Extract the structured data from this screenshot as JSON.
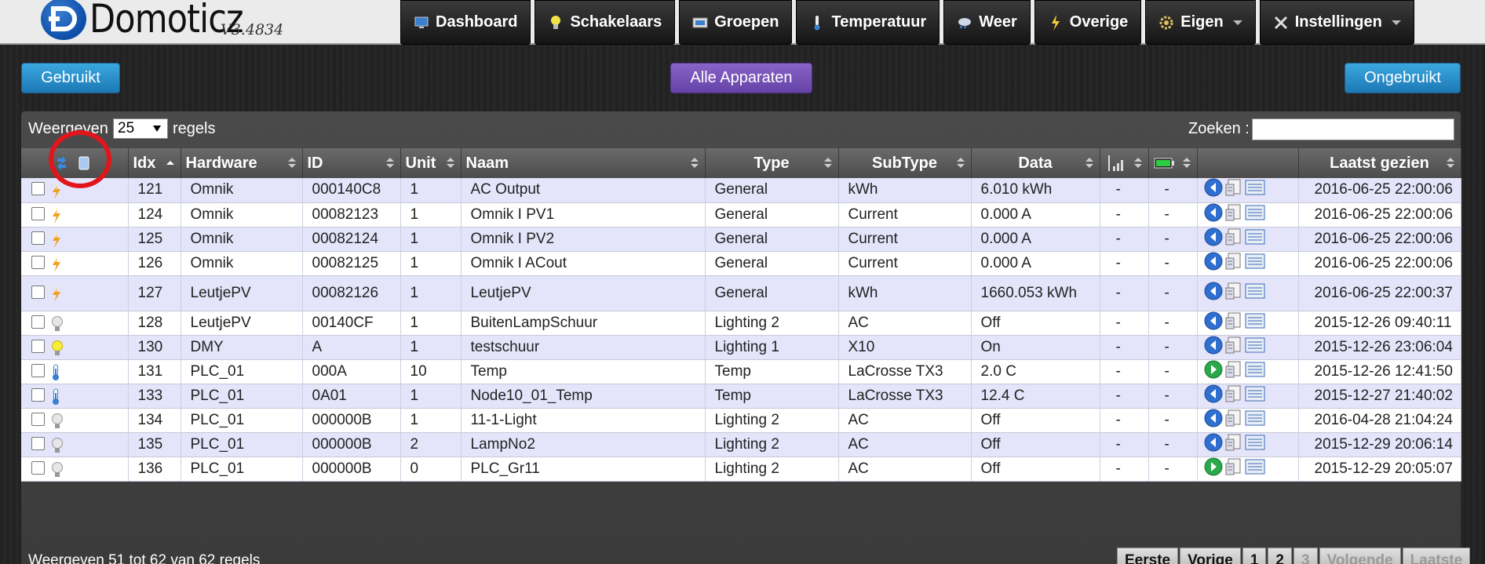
{
  "app": {
    "name": "Domoticz",
    "version": "V3.4834"
  },
  "nav": [
    {
      "label": "Dashboard",
      "icon": "monitor-icon",
      "dropdown": false
    },
    {
      "label": "Schakelaars",
      "icon": "bulb-icon",
      "dropdown": false
    },
    {
      "label": "Groepen",
      "icon": "scenes-icon",
      "dropdown": false
    },
    {
      "label": "Temperatuur",
      "icon": "thermometer-icon",
      "dropdown": false
    },
    {
      "label": "Weer",
      "icon": "weather-icon",
      "dropdown": false
    },
    {
      "label": "Overige",
      "icon": "lightning-icon",
      "dropdown": false
    },
    {
      "label": "Eigen",
      "icon": "gear-icon",
      "dropdown": true
    },
    {
      "label": "Instellingen",
      "icon": "tools-icon",
      "dropdown": true
    }
  ],
  "filters": {
    "used": "Gebruikt",
    "all": "Alle Apparaten",
    "unused": "Ongebruikt"
  },
  "toolbar": {
    "show_prefix": "Weergeven",
    "page_size": "25",
    "show_suffix": "regels",
    "search_label": "Zoeken :"
  },
  "columns": [
    "Idx",
    "Hardware",
    "ID",
    "Unit",
    "Naam",
    "Type",
    "SubType",
    "Data",
    "Laatst gezien"
  ],
  "rows": [
    {
      "icon": "electric-icon",
      "idx": "121",
      "hardware": "Omnik",
      "id": "000140C8",
      "unit": "1",
      "name": "AC Output",
      "type": "General",
      "subtype": "kWh",
      "data": "6.010 kWh",
      "signal": "-",
      "battery": "-",
      "action": "add",
      "lastseen": "2016-06-25 22:00:06"
    },
    {
      "icon": "electric-icon",
      "idx": "124",
      "hardware": "Omnik",
      "id": "00082123",
      "unit": "1",
      "name": "Omnik I PV1",
      "type": "General",
      "subtype": "Current",
      "data": "0.000 A",
      "signal": "-",
      "battery": "-",
      "action": "add",
      "lastseen": "2016-06-25 22:00:06"
    },
    {
      "icon": "electric-icon",
      "idx": "125",
      "hardware": "Omnik",
      "id": "00082124",
      "unit": "1",
      "name": "Omnik I PV2",
      "type": "General",
      "subtype": "Current",
      "data": "0.000 A",
      "signal": "-",
      "battery": "-",
      "action": "add",
      "lastseen": "2016-06-25 22:00:06"
    },
    {
      "icon": "electric-icon",
      "idx": "126",
      "hardware": "Omnik",
      "id": "00082125",
      "unit": "1",
      "name": "Omnik I ACout",
      "type": "General",
      "subtype": "Current",
      "data": "0.000 A",
      "signal": "-",
      "battery": "-",
      "action": "add",
      "lastseen": "2016-06-25 22:00:06"
    },
    {
      "icon": "electric-icon",
      "idx": "127",
      "hardware": "LeutjePV",
      "id": "00082126",
      "unit": "1",
      "name": "LeutjePV",
      "type": "General",
      "subtype": "kWh",
      "data": "1660.053 kWh",
      "signal": "-",
      "battery": "-",
      "action": "add",
      "lastseen": "2016-06-25 22:00:37"
    },
    {
      "icon": "bulb-off-icon",
      "idx": "128",
      "hardware": "LeutjePV",
      "id": "00140CF",
      "unit": "1",
      "name": "BuitenLampSchuur",
      "type": "Lighting 2",
      "subtype": "AC",
      "data": "Off",
      "signal": "-",
      "battery": "-",
      "action": "add",
      "lastseen": "2015-12-26 09:40:11"
    },
    {
      "icon": "bulb-on-icon",
      "idx": "130",
      "hardware": "DMY",
      "id": "A",
      "unit": "1",
      "name": "testschuur",
      "type": "Lighting 1",
      "subtype": "X10",
      "data": "On",
      "signal": "-",
      "battery": "-",
      "action": "add",
      "lastseen": "2015-12-26 23:06:04"
    },
    {
      "icon": "thermometer-icon",
      "idx": "131",
      "hardware": "PLC_01",
      "id": "000A",
      "unit": "10",
      "name": "Temp",
      "type": "Temp",
      "subtype": "LaCrosse TX3",
      "data": "2.0 C",
      "signal": "-",
      "battery": "-",
      "action": "remove",
      "lastseen": "2015-12-26 12:41:50"
    },
    {
      "icon": "thermometer-icon",
      "idx": "133",
      "hardware": "PLC_01",
      "id": "0A01",
      "unit": "1",
      "name": "Node10_01_Temp",
      "type": "Temp",
      "subtype": "LaCrosse TX3",
      "data": "12.4 C",
      "signal": "-",
      "battery": "-",
      "action": "add",
      "lastseen": "2015-12-27 21:40:02"
    },
    {
      "icon": "bulb-off-icon",
      "idx": "134",
      "hardware": "PLC_01",
      "id": "000000B",
      "unit": "1",
      "name": "11-1-Light",
      "type": "Lighting 2",
      "subtype": "AC",
      "data": "Off",
      "signal": "-",
      "battery": "-",
      "action": "add",
      "lastseen": "2016-04-28 21:04:24"
    },
    {
      "icon": "bulb-off-icon",
      "idx": "135",
      "hardware": "PLC_01",
      "id": "000000B",
      "unit": "2",
      "name": "LampNo2",
      "type": "Lighting 2",
      "subtype": "AC",
      "data": "Off",
      "signal": "-",
      "battery": "-",
      "action": "add",
      "lastseen": "2015-12-29 20:06:14"
    },
    {
      "icon": "bulb-off-icon",
      "idx": "136",
      "hardware": "PLC_01",
      "id": "000000B",
      "unit": "0",
      "name": "PLC_Gr11",
      "type": "Lighting 2",
      "subtype": "AC",
      "data": "Off",
      "signal": "-",
      "battery": "-",
      "action": "remove",
      "lastseen": "2015-12-29 20:05:07"
    }
  ],
  "footer": {
    "info": "Weergeven 51 tot 62 van 62 regels"
  },
  "pager": {
    "first": "Eerste",
    "prev": "Vorige",
    "p1": "1",
    "p2": "2",
    "p3": "3",
    "next": "Volgende",
    "last": "Laatste"
  },
  "colors": {
    "odd_row": "#e4e4fa",
    "even_row": "#ffffff",
    "nav_bg": "#1e1e1e",
    "accent_blue": "#1c78b4",
    "accent_purple": "#6442a6",
    "annotation_red": "#e0161c"
  }
}
